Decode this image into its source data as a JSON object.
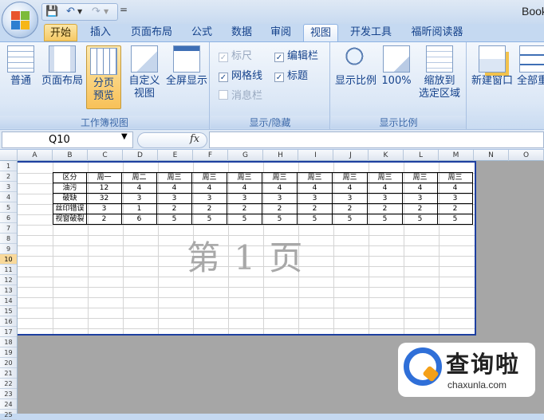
{
  "title_bar": {
    "app_title": "Book"
  },
  "quick_access": {
    "undo": "↶",
    "redo": "↷",
    "save": "💾",
    "more": "="
  },
  "tabs": [
    {
      "label": "开始"
    },
    {
      "label": "插入"
    },
    {
      "label": "页面布局"
    },
    {
      "label": "公式"
    },
    {
      "label": "数据"
    },
    {
      "label": "审阅"
    },
    {
      "label": "视图"
    },
    {
      "label": "开发工具"
    },
    {
      "label": "福昕阅读器"
    }
  ],
  "ribbon": {
    "workbook_views": {
      "group_label": "工作簿视图",
      "normal": "普通",
      "page_layout": "页面布局",
      "page_break_line1": "分页",
      "page_break_line2": "预览",
      "custom_view_line1": "自定义",
      "custom_view_line2": "视图",
      "full_screen": "全屏显示"
    },
    "show_hide": {
      "group_label": "显示/隐藏",
      "ruler": "标尺",
      "gridlines": "网格线",
      "message_bar": "消息栏",
      "formula_bar": "编辑栏",
      "headings": "标题",
      "check_mark": "✓"
    },
    "zoom": {
      "group_label": "显示比例",
      "zoom": "显示比例",
      "hundred": "100%",
      "zoom_sel_line1": "缩放到",
      "zoom_sel_line2": "选定区域"
    },
    "window": {
      "new_window": "新建窗口",
      "arrange_all": "全部重"
    }
  },
  "formula_bar": {
    "name_box": "Q10",
    "name_arrow": "▼",
    "fx": "fx",
    "value": ""
  },
  "columns": [
    "A",
    "B",
    "C",
    "D",
    "E",
    "F",
    "G",
    "H",
    "I",
    "J",
    "K",
    "L",
    "M",
    "N",
    "O"
  ],
  "rows": [
    "1",
    "2",
    "3",
    "4",
    "5",
    "6",
    "7",
    "8",
    "9",
    "10",
    "11",
    "12",
    "13",
    "14",
    "15",
    "16",
    "17",
    "18",
    "19",
    "20",
    "21",
    "22",
    "23",
    "24",
    "25"
  ],
  "selected_row": "10",
  "watermark": "第 1 页",
  "table": {
    "header": [
      "区分",
      "周一",
      "周二",
      "周三",
      "周三",
      "周三",
      "周三",
      "周三",
      "周三",
      "周三",
      "周三",
      "周三"
    ],
    "rows": [
      [
        "油污",
        "12",
        "4",
        "4",
        "4",
        "4",
        "4",
        "4",
        "4",
        "4",
        "4",
        "4"
      ],
      [
        "破缺",
        "32",
        "3",
        "3",
        "3",
        "3",
        "3",
        "3",
        "3",
        "3",
        "3",
        "3"
      ],
      [
        "丝印错误",
        "3",
        "1",
        "2",
        "2",
        "2",
        "2",
        "2",
        "2",
        "2",
        "2",
        "2"
      ],
      [
        "视窗破裂",
        "2",
        "6",
        "5",
        "5",
        "5",
        "5",
        "5",
        "5",
        "5",
        "5",
        "5"
      ]
    ]
  },
  "brand": {
    "cn": "查询啦",
    "en": "chaxunla.com"
  }
}
